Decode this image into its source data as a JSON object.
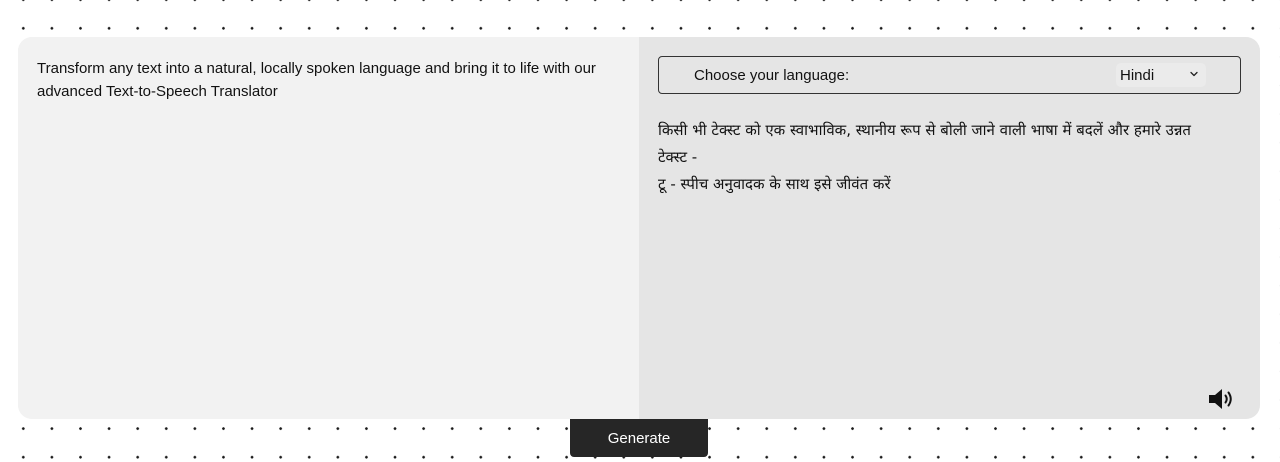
{
  "input": {
    "text": "Transform any text into a natural, locally spoken language and bring it to life with our\nadvanced Text-to-Speech Translator"
  },
  "output": {
    "language_label": "Choose your language:",
    "selected_language": "Hindi",
    "translated_text": "किसी भी टेक्स्ट को एक स्वाभाविक, स्थानीय रूप से बोली जाने वाली भाषा में बदलें और हमारे उन्नत टेक्स्ट -\nटू - स्पीच अनुवादक के साथ इसे जीवंत करें",
    "speaker_icon": "speaker-icon"
  },
  "actions": {
    "generate_label": "Generate"
  },
  "colors": {
    "input_bg": "#f2f2f2",
    "output_bg": "#e5e5e5",
    "button_bg": "#262626",
    "button_text": "#ffffff"
  }
}
